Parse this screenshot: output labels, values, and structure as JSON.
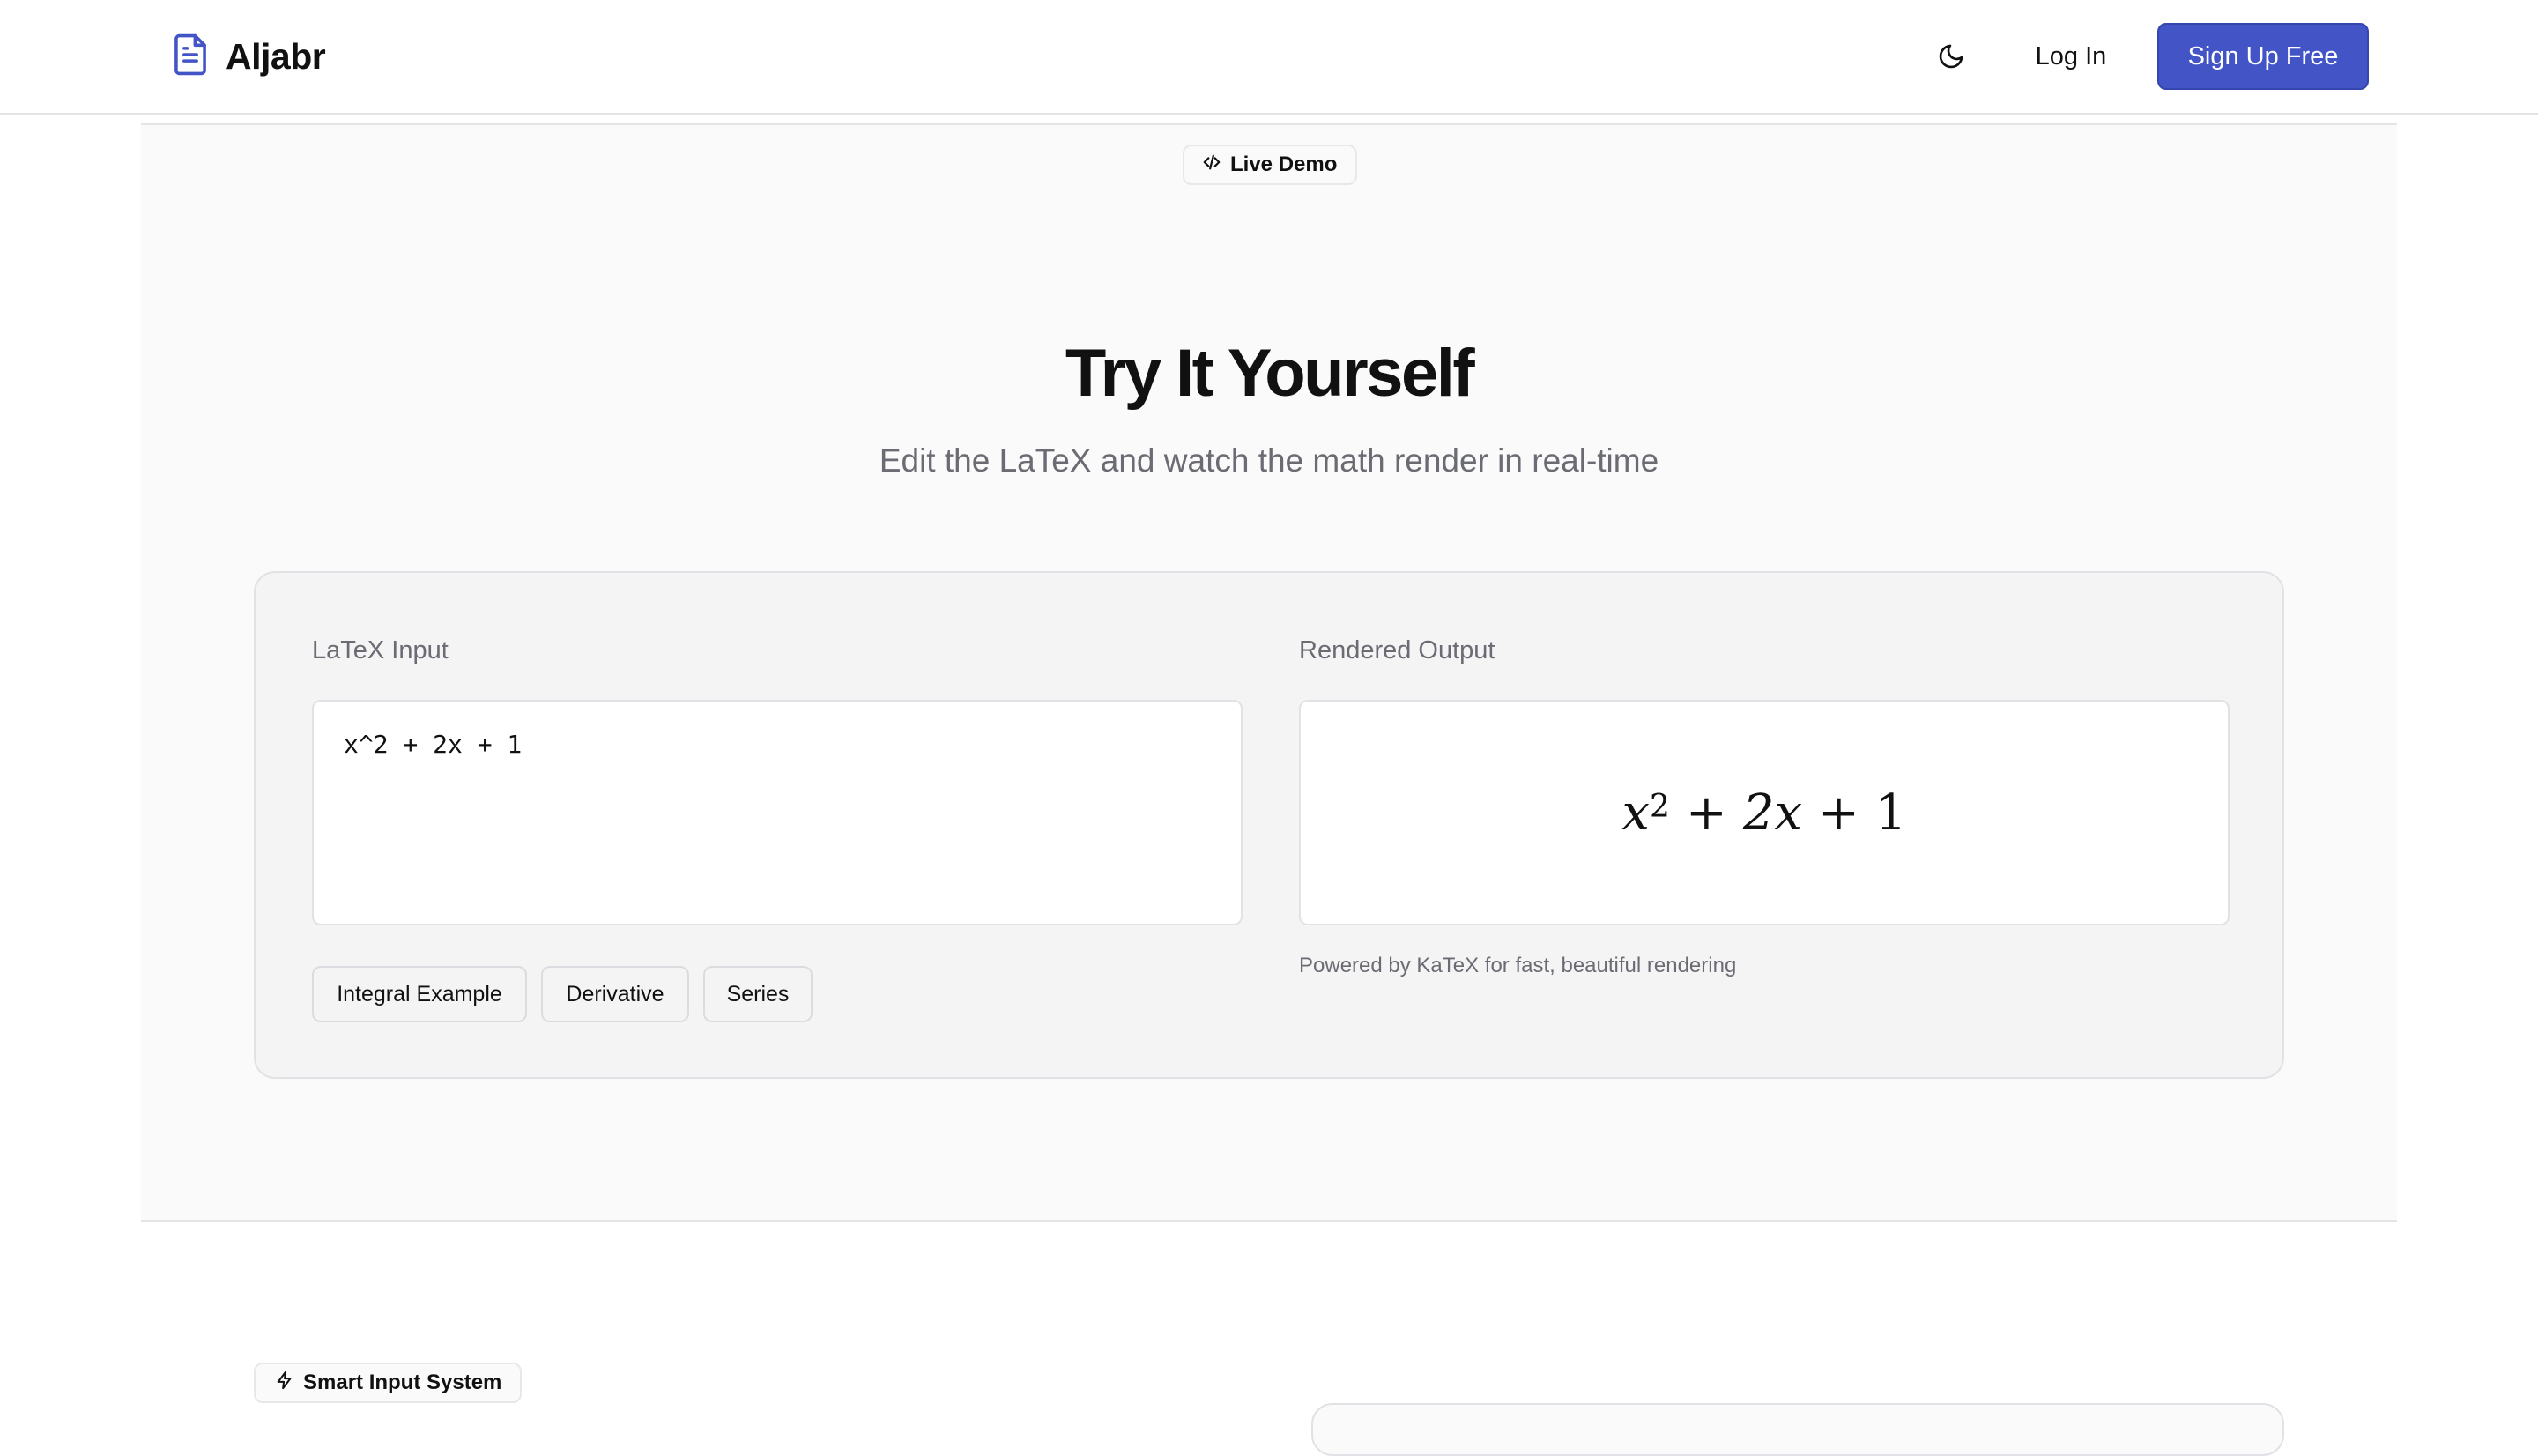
{
  "header": {
    "brand": "Aljabr",
    "logo_icon": "document-icon",
    "theme_icon": "moon-icon",
    "login_label": "Log In",
    "signup_label": "Sign Up Free",
    "accent_color": "#4355c6"
  },
  "demo": {
    "badge_icon": "code-icon",
    "badge_label": "Live Demo",
    "title": "Try It Yourself",
    "subtitle": "Edit the LaTeX and watch the math render in real-time",
    "input_label": "LaTeX Input",
    "input_value": "x^2 + 2x + 1",
    "output_label": "Rendered Output",
    "rendered": {
      "base": "x",
      "exponent": "2",
      "plus1": "+",
      "term2": "2x",
      "plus2": "+",
      "term3": "1"
    },
    "powered_by": "Powered by KaTeX for fast, beautiful rendering",
    "examples": [
      "Integral Example",
      "Derivative",
      "Series"
    ]
  },
  "next_section": {
    "badge_icon": "lightning-icon",
    "badge_label": "Smart Input System"
  }
}
